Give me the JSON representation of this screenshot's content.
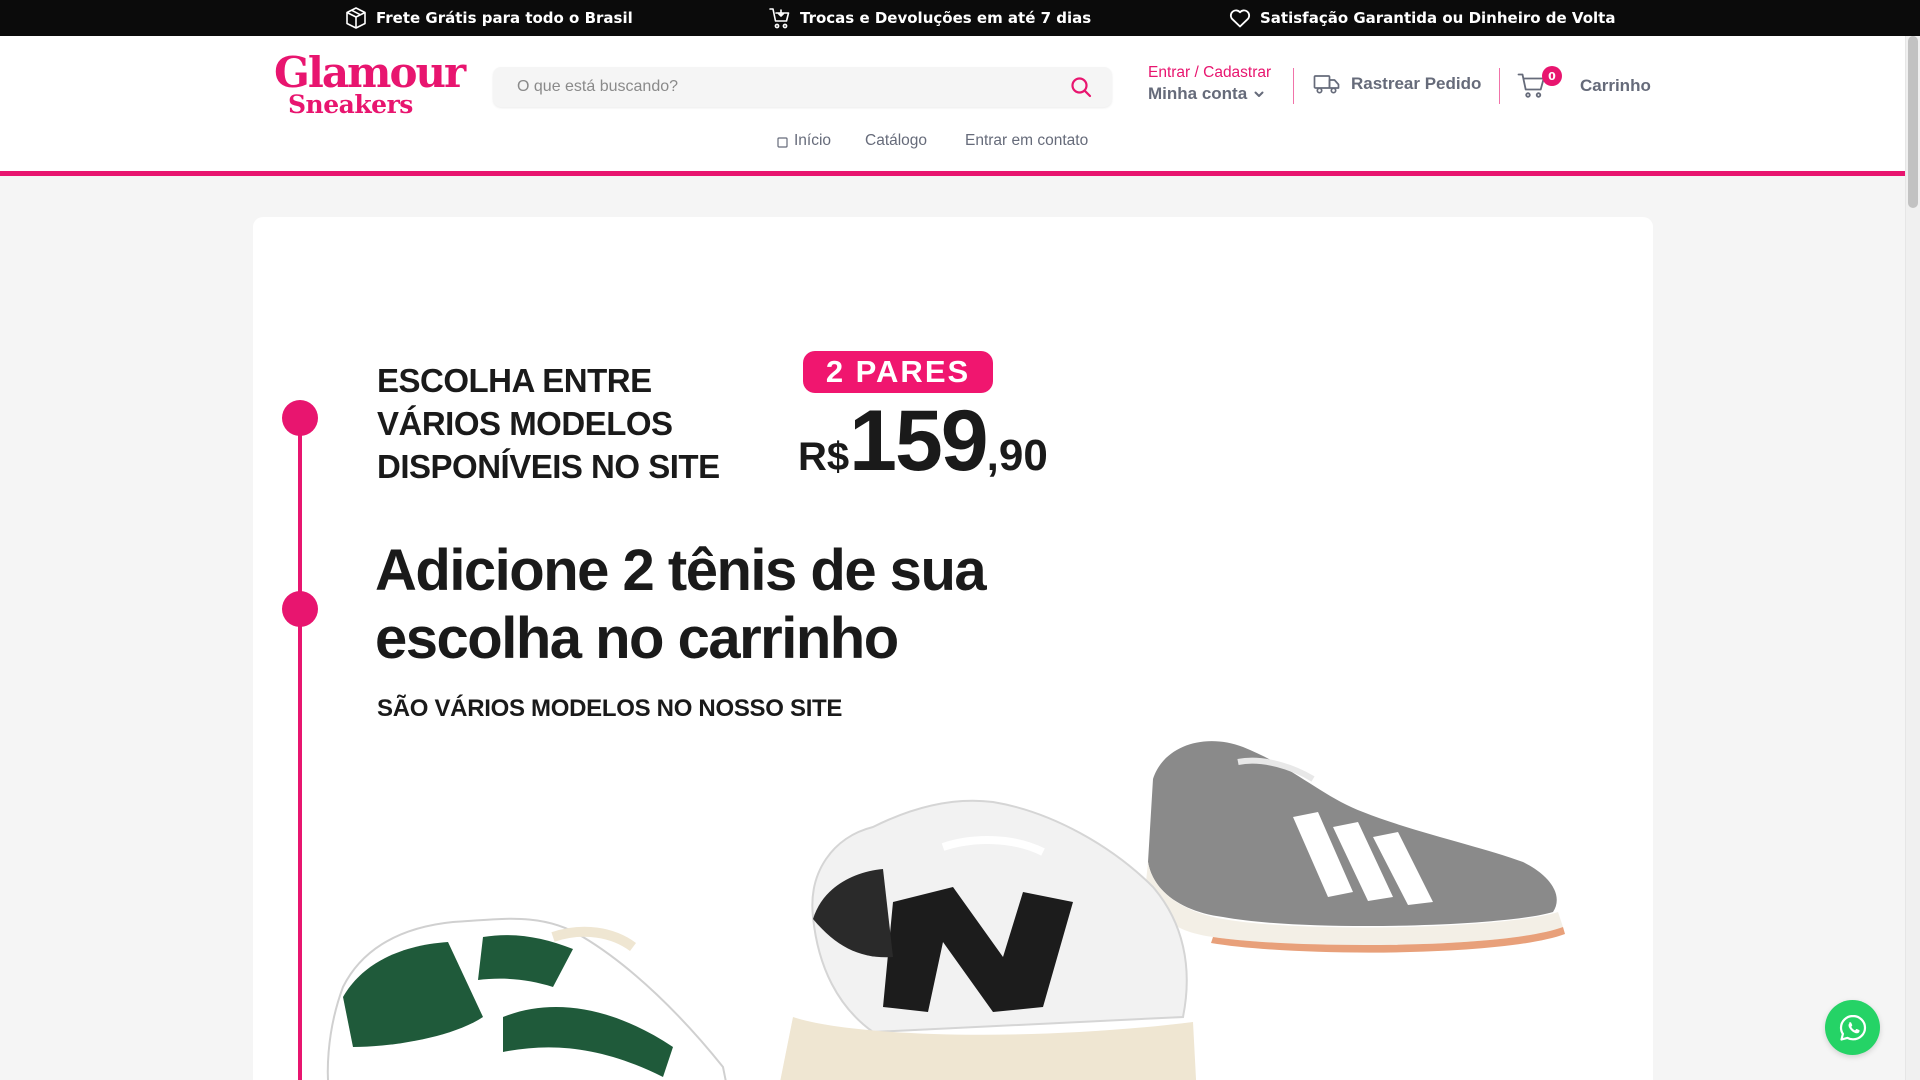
{
  "topbar": {
    "items": [
      {
        "icon": "package-icon",
        "text": "Frete Grátis para todo o Brasil"
      },
      {
        "icon": "cart-return-icon",
        "text": "Trocas e Devoluções em até 7 dias"
      },
      {
        "icon": "heart-icon",
        "text": "Satisfação Garantida ou Dinheiro de Volta"
      }
    ]
  },
  "header": {
    "logo": {
      "line1": "Glamour",
      "line2": "Sneakers"
    },
    "search": {
      "placeholder": "O que está buscando?",
      "value": ""
    },
    "account": {
      "login_label": "Entrar / Cadastrar",
      "my_account_label": "Minha conta"
    },
    "track_label": "Rastrear Pedido",
    "cart": {
      "count": "0",
      "label": "Carrinho"
    }
  },
  "nav": {
    "items": [
      {
        "label": "Início",
        "icon": "home-icon"
      },
      {
        "label": "Catálogo"
      },
      {
        "label": "Entrar em contato"
      }
    ]
  },
  "banner": {
    "line1": "ESCOLHA ENTRE",
    "line2": "VÁRIOS MODELOS",
    "line3": "DISPONÍVEIS NO SITE",
    "pill": "2 PARES",
    "price_currency": "R$",
    "price_int": "159",
    "price_cents": ",90",
    "headline1": "Adicione 2 tênis de sua",
    "headline2": "escolha no carrinho",
    "sub": "SÃO VÁRIOS MODELOS NO NOSSO SITE"
  },
  "colors": {
    "accent": "#e8156f",
    "topbar_bg": "#0b0b0b",
    "whatsapp": "#25d366"
  }
}
